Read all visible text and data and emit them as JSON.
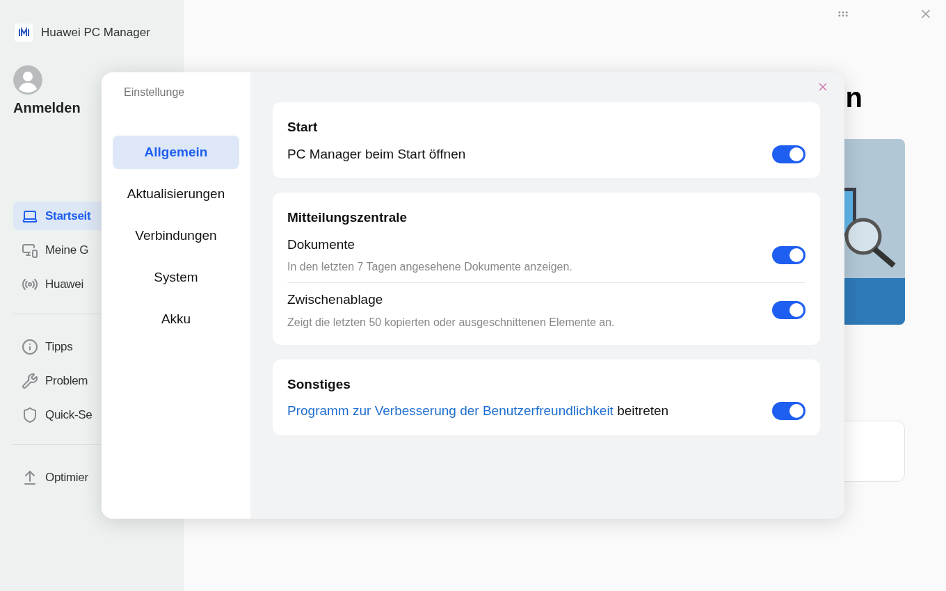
{
  "window": {
    "title": "Huawei PC Manager"
  },
  "account": {
    "label": "Anmelden"
  },
  "sidebar": {
    "items": [
      {
        "label": "Startseit",
        "selected": true
      },
      {
        "label": "Meine G",
        "selected": false
      },
      {
        "label": "Huawei",
        "selected": false
      },
      {
        "label": "Tipps",
        "selected": false
      },
      {
        "label": "Problem",
        "selected": false
      },
      {
        "label": "Quick-Se",
        "selected": false
      },
      {
        "label": "Optimier",
        "selected": false
      }
    ]
  },
  "main": {
    "heading": "n"
  },
  "settings": {
    "title": "Einstellunge",
    "nav": [
      {
        "label": "Allgemein",
        "selected": true
      },
      {
        "label": "Aktualisierungen",
        "selected": false
      },
      {
        "label": "Verbindungen",
        "selected": false
      },
      {
        "label": "System",
        "selected": false
      },
      {
        "label": "Akku",
        "selected": false
      }
    ],
    "sections": [
      {
        "title": "Start",
        "items": [
          {
            "kind": "plain",
            "label": "PC Manager beim Start öffnen",
            "on": true
          }
        ]
      },
      {
        "title": "Mitteilungszentrale",
        "items": [
          {
            "kind": "plain",
            "label": "Dokumente",
            "description": "In den letzten 7 Tagen angesehene Dokumente anzeigen.",
            "on": true
          },
          {
            "kind": "plain",
            "label": "Zwischenablage",
            "description": "Zeigt die letzten 50 kopierten oder ausgeschnittenen Elemente an.",
            "on": true
          }
        ]
      },
      {
        "title": "Sonstiges",
        "items": [
          {
            "kind": "link",
            "link": "Programm zur Verbesserung der Benutzerfreundlichkeit",
            "label": "beitreten",
            "on": true
          }
        ]
      }
    ]
  }
}
